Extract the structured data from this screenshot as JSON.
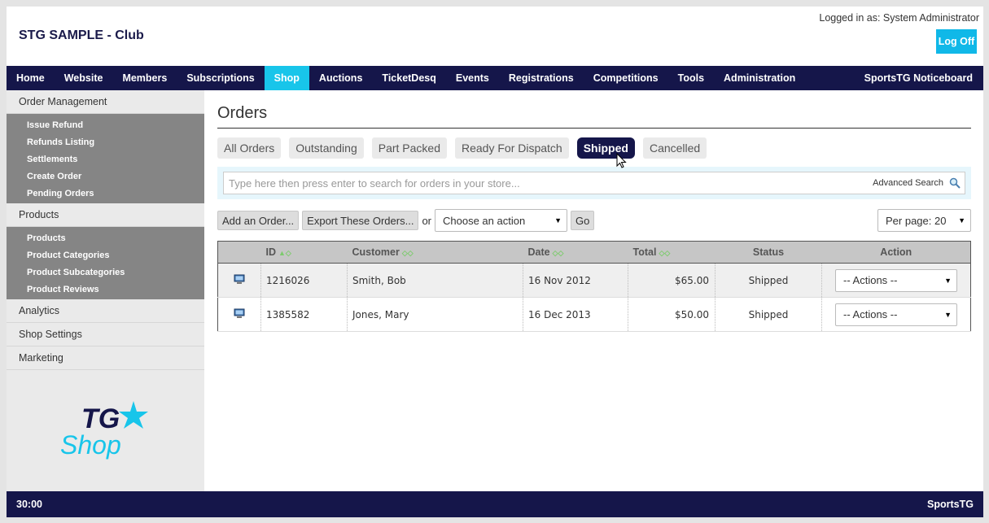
{
  "header": {
    "club_title": "STG SAMPLE - Club",
    "logged_in": "Logged in as: System Administrator",
    "logoff_label": "Log Off"
  },
  "topnav": {
    "items": [
      "Home",
      "Website",
      "Members",
      "Subscriptions",
      "Shop",
      "Auctions",
      "TicketDesq",
      "Events",
      "Registrations",
      "Competitions",
      "Tools",
      "Administration"
    ],
    "active": "Shop",
    "right_item": "SportsTG Noticeboard"
  },
  "sidebar": {
    "order_management": "Order Management",
    "order_items": [
      "Issue Refund",
      "Refunds Listing",
      "Settlements",
      "Create Order",
      "Pending Orders"
    ],
    "products": "Products",
    "product_items": [
      "Products",
      "Product Categories",
      "Product Subcategories",
      "Product Reviews"
    ],
    "analytics": "Analytics",
    "shop_settings": "Shop Settings",
    "marketing": "Marketing",
    "logo_top": "TG",
    "logo_bottom": "Shop"
  },
  "main": {
    "title": "Orders",
    "tabs": [
      "All Orders",
      "Outstanding",
      "Part Packed",
      "Ready For Dispatch",
      "Shipped",
      "Cancelled"
    ],
    "active_tab": "Shipped",
    "search_placeholder": "Type here then press enter to search for orders in your store...",
    "advanced_search": "Advanced Search",
    "add_order": "Add an Order...",
    "export_orders": "Export These Orders...",
    "or_text": "or",
    "action_select": "Choose an action",
    "go_label": "Go",
    "per_page": "Per page: 20"
  },
  "table": {
    "headers": {
      "id": "ID",
      "customer": "Customer",
      "date": "Date",
      "total": "Total",
      "status": "Status",
      "action": "Action"
    },
    "rows": [
      {
        "id": "1216026",
        "customer": "Smith, Bob",
        "date": "16 Nov 2012",
        "total": "$65.00",
        "status": "Shipped",
        "action": "-- Actions --"
      },
      {
        "id": "1385582",
        "customer": "Jones, Mary",
        "date": "16 Dec 2013",
        "total": "$50.00",
        "status": "Shipped",
        "action": "-- Actions --"
      }
    ]
  },
  "footer": {
    "timer": "30:00",
    "brand": "SportsTG"
  },
  "colors": {
    "navy": "#15164a",
    "accent": "#18c5ea",
    "logoff": "#10b8e8"
  }
}
